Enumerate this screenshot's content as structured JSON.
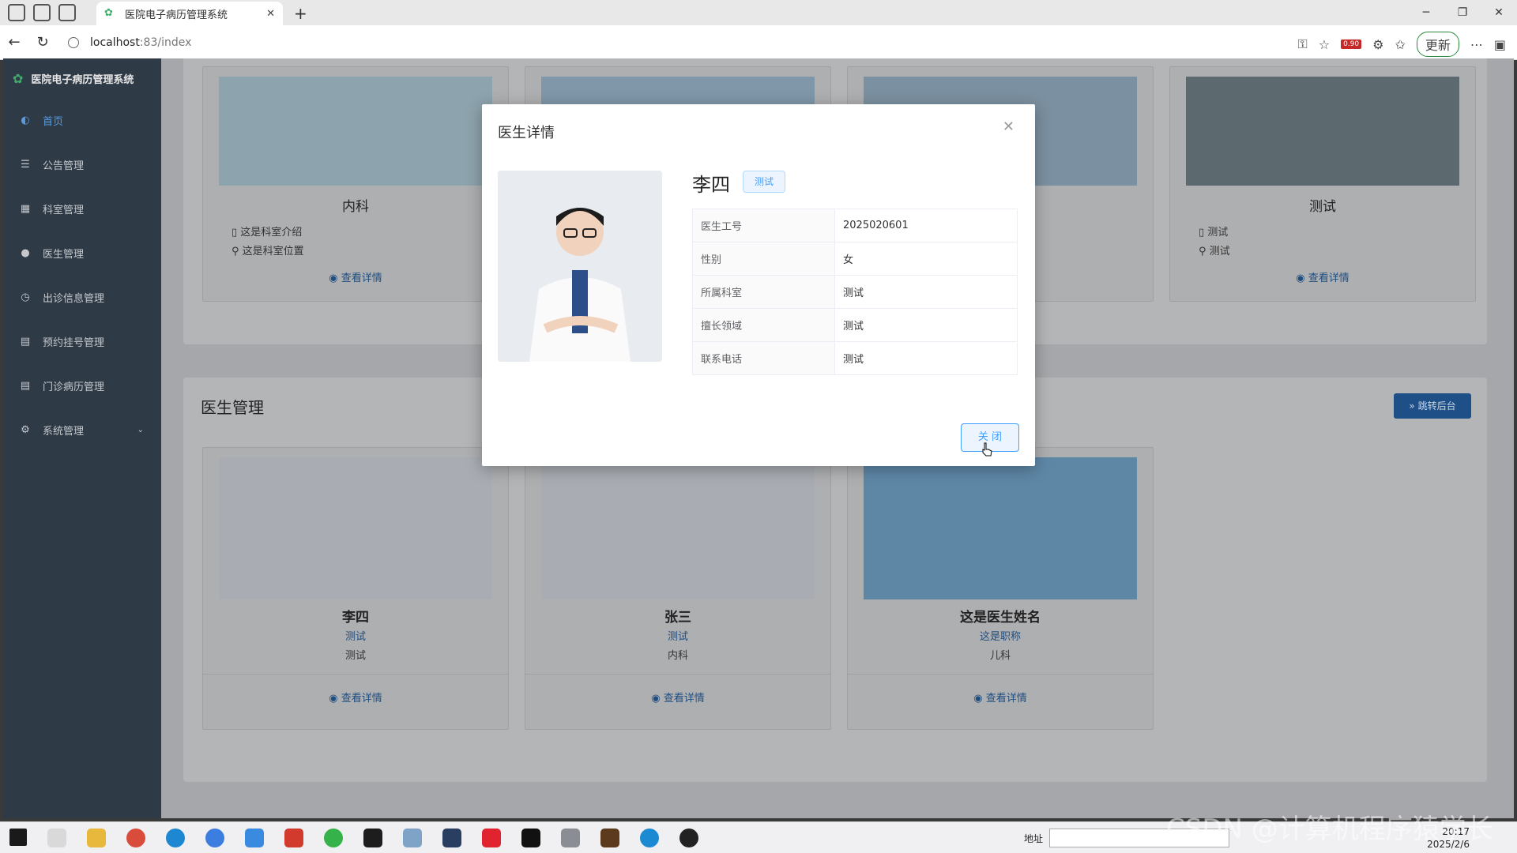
{
  "browser": {
    "tab_title": "医院电子病历管理系统",
    "url_host": "localhost",
    "url_port": ":83/index",
    "update_label": "更新",
    "badge": "0.90"
  },
  "sidebar": {
    "system_name": "医院电子病历管理系统",
    "items": [
      {
        "label": "首页",
        "icon": "dashboard-icon"
      },
      {
        "label": "公告管理",
        "icon": "list-icon"
      },
      {
        "label": "科室管理",
        "icon": "grid-icon"
      },
      {
        "label": "医生管理",
        "icon": "user-icon"
      },
      {
        "label": "出诊信息管理",
        "icon": "clock-icon"
      },
      {
        "label": "预约挂号管理",
        "icon": "document-icon"
      },
      {
        "label": "门诊病历管理",
        "icon": "document-icon"
      },
      {
        "label": "系统管理",
        "icon": "gear-icon"
      }
    ]
  },
  "departments": {
    "cards": [
      {
        "name": "内科",
        "intro": "这是科室介绍",
        "location": "这是科室位置",
        "detail": "查看详情"
      },
      {
        "name": "测试",
        "intro": "测试",
        "location": "测试",
        "detail": "查看详情"
      }
    ]
  },
  "doctors": {
    "section_title": "医生管理",
    "jump_label": "跳转后台",
    "cards": [
      {
        "name": "李四",
        "title": "测试",
        "dept": "测试",
        "detail": "查看详情"
      },
      {
        "name": "张三",
        "title": "测试",
        "dept": "内科",
        "detail": "查看详情"
      },
      {
        "name": "这是医生姓名",
        "title": "这是职称",
        "dept": "儿科",
        "detail": "查看详情"
      }
    ]
  },
  "modal": {
    "title": "医生详情",
    "doctor_name": "李四",
    "tag": "测试",
    "fields": [
      {
        "label": "医生工号",
        "value": "2025020601"
      },
      {
        "label": "性别",
        "value": "女"
      },
      {
        "label": "所属科室",
        "value": "测试"
      },
      {
        "label": "擅长领域",
        "value": "测试"
      },
      {
        "label": "联系电话",
        "value": "测试"
      }
    ],
    "close_label": "关 闭"
  },
  "taskbar": {
    "address_label": "地址",
    "time": "20:17",
    "date": "2025/2/6"
  },
  "watermark": "CSDN @计算机程序猿学长",
  "colors": {
    "accent": "#409eff",
    "sidebar": "#2f3a47",
    "brand": "#3fae6a"
  }
}
